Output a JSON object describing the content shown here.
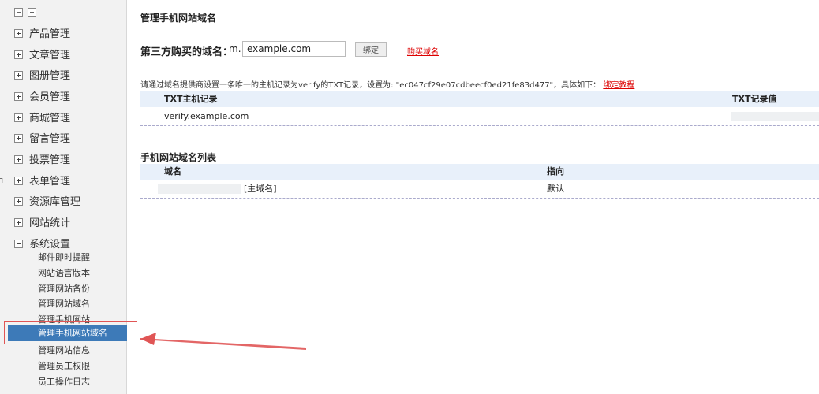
{
  "sidebar": {
    "groups": [
      {
        "label": "产品管理"
      },
      {
        "label": "文章管理"
      },
      {
        "label": "图册管理"
      },
      {
        "label": "会员管理"
      },
      {
        "label": "商城管理"
      },
      {
        "label": "留言管理"
      },
      {
        "label": "投票管理"
      },
      {
        "label": "表单管理"
      },
      {
        "label": "资源库管理"
      },
      {
        "label": "网站统计"
      },
      {
        "label": "系统设置"
      }
    ],
    "sub_items": [
      {
        "label": "邮件即时提醒"
      },
      {
        "label": "网站语言版本"
      },
      {
        "label": "管理网站备份"
      },
      {
        "label": "管理网站域名"
      },
      {
        "label": "管理手机网站"
      },
      {
        "label": "管理手机网站域名"
      },
      {
        "label": "管理网站信息"
      },
      {
        "label": "管理员工权限"
      },
      {
        "label": "员工操作日志"
      }
    ],
    "edge_mark": "п"
  },
  "main": {
    "title": "管理手机网站域名",
    "domain_label": "第三方购买的域名：",
    "domain_prefix": "m.",
    "domain_value": "example.com",
    "bind_button": "绑定",
    "buy_link": "购买域名",
    "tip_text": "请通过域名提供商设置一条唯一的主机记录为verify的TXT记录，设置为: \"ec047cf29e07cdbeecf0ed21fe83d477\"，具体如下：",
    "tip_link": "绑定教程",
    "txt_table": {
      "headers": [
        "TXT主机记录",
        "TXT记录值"
      ],
      "rows": [
        [
          "verify.example.com",
          ""
        ]
      ]
    },
    "list_title": "手机网站域名列表",
    "list_table": {
      "headers": [
        "域名",
        "指向"
      ],
      "rows": [
        [
          "[主域名]",
          "默认"
        ]
      ]
    }
  },
  "colors": {
    "active_bg": "#3d7ab8",
    "header_bg": "#e8f0fa",
    "link": "#dd0000",
    "highlight": "#e05555"
  }
}
